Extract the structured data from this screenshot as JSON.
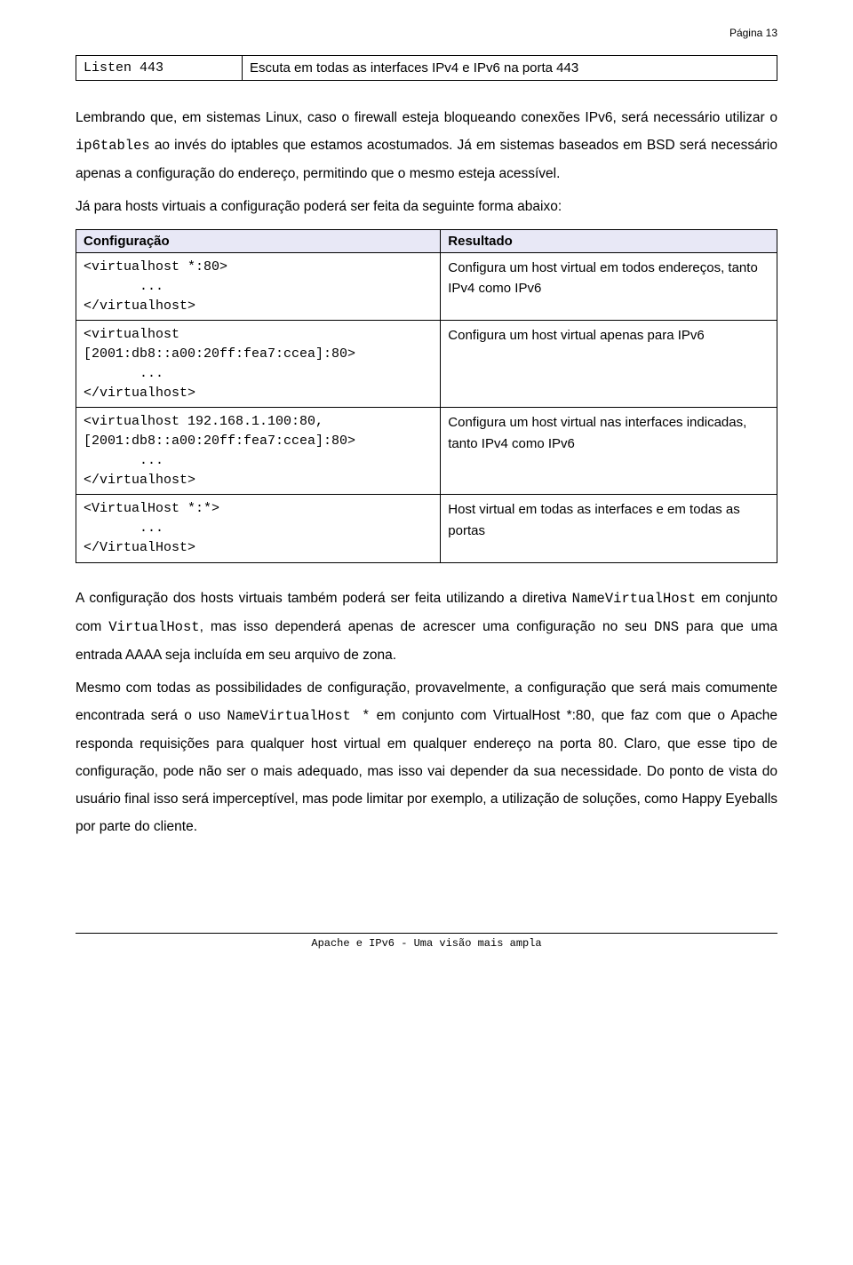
{
  "page_number": "Página 13",
  "top_table": {
    "left": "Listen 443",
    "right": "Escuta em todas as interfaces IPv4 e IPv6 na porta 443"
  },
  "para1_a": "Lembrando que, em sistemas Linux, caso o firewall esteja bloqueando conexões IPv6, será necessário utilizar o ",
  "para1_mono": "ip6tables",
  "para1_b": " ao invés do iptables que estamos acostumados. Já em sistemas baseados em BSD será necessário apenas a configuração do endereço, permitindo que o mesmo esteja acessível.",
  "para2": "Já para hosts virtuais a configuração poderá ser feita da seguinte forma abaixo:",
  "config_table": {
    "header_left": "Configuração",
    "header_right": "Resultado",
    "rows": [
      {
        "code": "<virtualhost *:80>\n       ...\n</virtualhost>",
        "result": "Configura um host virtual em todos endereços, tanto IPv4 como IPv6"
      },
      {
        "code": "<virtualhost [2001:db8::a00:20ff:fea7:ccea]:80>\n       ...\n</virtualhost>",
        "result": "Configura um host virtual apenas para IPv6"
      },
      {
        "code": "<virtualhost 192.168.1.100:80, [2001:db8::a00:20ff:fea7:ccea]:80>\n       ...\n</virtualhost>",
        "result": "Configura um host virtual nas interfaces indicadas, tanto IPv4 como IPv6"
      },
      {
        "code": "<VirtualHost *:*>\n       ...\n</VirtualHost>",
        "result": "Host virtual em todas as interfaces e em todas as portas"
      }
    ]
  },
  "para3_a": "A configuração dos hosts virtuais também poderá ser feita utilizando a diretiva ",
  "para3_mono1": "NameVirtualHost",
  "para3_b": " em conjunto com ",
  "para3_mono2": "VirtualHost",
  "para3_c": ", mas isso dependerá apenas de acrescer uma configuração no seu ",
  "para3_mono3": "DNS",
  "para3_d": " para que uma entrada AAAA seja incluída em seu arquivo de zona.",
  "para4_a": "Mesmo com todas as possibilidades de configuração, provavelmente, a configuração que será mais comumente encontrada será o uso ",
  "para4_mono1": "NameVirtualHost *",
  "para4_b": " em conjunto com VirtualHost *:80, que faz com que o Apache responda requisições para qualquer host virtual em qualquer endereço na porta 80. Claro, que esse tipo de configuração, pode não ser o mais adequado, mas isso vai depender da sua necessidade. Do ponto de vista do usuário final isso será imperceptível, mas pode limitar por exemplo, a utilização de soluções, como Happy Eyeballs por parte do cliente.",
  "footer": "Apache e IPv6 - Uma visão mais ampla"
}
